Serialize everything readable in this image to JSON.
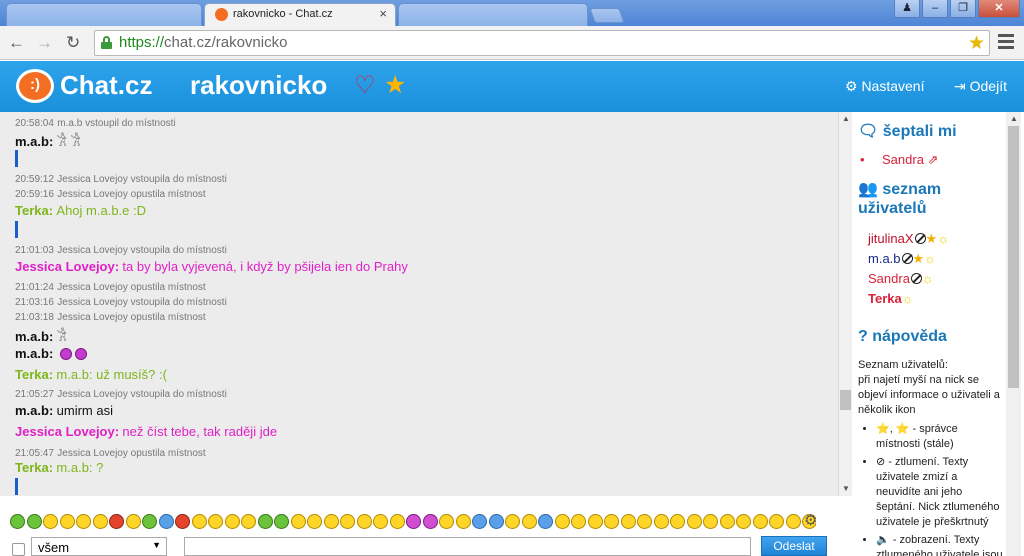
{
  "browser": {
    "tab_title": "rakovnicko - Chat.cz",
    "tab_close": "×",
    "url_scheme": "https://",
    "url_host": "chat.cz",
    "url_path": "/rakovnicko",
    "back": "←",
    "forward": "→",
    "reload": "↻",
    "bookmark_star": "★",
    "win_user": "♟",
    "win_min": "–",
    "win_max": "❐",
    "win_close": "✕"
  },
  "header": {
    "logo_text": "Chat.cz",
    "logo_smile": ":)",
    "room_title": "rakovnicko",
    "heart": "♡",
    "fav_star": "★",
    "settings_label": "⚙ Nastavení",
    "logout_label": "⇥ Odejít"
  },
  "messages": [
    {
      "type": "sys",
      "time": "20:58:04",
      "text": "m.a.b vstoupil do místnosti"
    },
    {
      "type": "chat",
      "nick": "m.a.b:",
      "text": "𓀟 𓀟",
      "color": "mab"
    },
    {
      "type": "bar"
    },
    {
      "type": "sys",
      "time": "20:59:12",
      "text": "Jessica Lovejoy vstoupila do místnosti"
    },
    {
      "type": "sys",
      "time": "20:59:16",
      "text": "Jessica Lovejoy opustila místnost"
    },
    {
      "type": "chat",
      "nick": "Terka:",
      "text": "Ahoj m.a.b.e :D",
      "color": "terka"
    },
    {
      "type": "bar"
    },
    {
      "type": "sys",
      "time": "21:01:03",
      "text": "Jessica Lovejoy vstoupila do místnosti"
    },
    {
      "type": "chat",
      "nick": "Jessica Lovejoy:",
      "text": "ta by byla vyjevená, i když by pšijela ien do Prahy",
      "color": "jess"
    },
    {
      "type": "sys",
      "time": "21:01:24",
      "text": "Jessica Lovejoy opustila místnost"
    },
    {
      "type": "sys",
      "time": "21:03:16",
      "text": "Jessica Lovejoy vstoupila do místnosti"
    },
    {
      "type": "sys",
      "time": "21:03:18",
      "text": "Jessica Lovejoy opustila místnost"
    },
    {
      "type": "chat",
      "nick": "m.a.b:",
      "text": "𓀟",
      "color": "mab"
    },
    {
      "type": "chat",
      "nick": "m.a.b:",
      "text": "",
      "color": "mab",
      "emoticons": 2
    },
    {
      "type": "chat",
      "nick": "Terka:",
      "text": "m.a.b: už musíš? :(",
      "color": "terka"
    },
    {
      "type": "sys",
      "time": "21:05:27",
      "text": "Jessica Lovejoy vstoupila do místnosti"
    },
    {
      "type": "chat",
      "nick": "m.a.b:",
      "text": "umirm asi",
      "color": "mab"
    },
    {
      "type": "chat",
      "nick": "Jessica Lovejoy:",
      "text": "než číst tebe, tak raději jde",
      "color": "jess"
    },
    {
      "type": "sys",
      "time": "21:05:47",
      "text": "Jessica Lovejoy opustila místnost"
    },
    {
      "type": "chat",
      "nick": "Terka:",
      "text": "m.a.b: ?",
      "color": "terka"
    },
    {
      "type": "bar"
    }
  ],
  "sidebar": {
    "whisper_heading": "šeptali mi",
    "whisper_icon": "🗨",
    "whisper_user": "Sandra",
    "whisper_user_icon": "⇗",
    "userlist_heading_1": "seznam",
    "userlist_heading_2": "uživatelů",
    "userlist_icon": "👥",
    "users": [
      {
        "name": "jitulinaX",
        "color": "#c0102a",
        "ban": true,
        "star": true,
        "sun": true,
        "bold": false
      },
      {
        "name": "m.a.b",
        "color": "#1a2a8a",
        "ban": true,
        "star": true,
        "sun": true,
        "bold": false
      },
      {
        "name": "Sandra",
        "color": "#d8223a",
        "ban": true,
        "star": false,
        "sun": true,
        "bold": false
      },
      {
        "name": "Terka",
        "color": "#d8223a",
        "ban": false,
        "star": false,
        "sun": true,
        "bold": true
      }
    ],
    "help_heading": "nápověda",
    "help_icon": "?",
    "help_intro": "Seznam uživatelů:",
    "help_line": "při najetí myší na nick se objeví informace o uživateli a několik ikon",
    "help_items": [
      "⭐, ⭐ - správce místnosti (stále)",
      "⊘ - ztlumení. Texty uživatele zmizí a neuvidíte ani jeho šeptání. Nick ztlumeného uživatele je přeškrtnutý",
      "🔈 - zobrazení. Texty ztlumeného uživatele jsou opět vidět"
    ]
  },
  "bottom": {
    "select_value": "všem",
    "send_label": "Odeslat",
    "gear": "⚙",
    "emoji_colors": [
      "g",
      "g",
      "y",
      "y",
      "y",
      "y",
      "r",
      "y",
      "g",
      "b",
      "r",
      "y",
      "y",
      "y",
      "y",
      "g",
      "g",
      "y",
      "y",
      "y",
      "y",
      "y",
      "y",
      "y",
      "p",
      "p",
      "y",
      "y",
      "b",
      "b",
      "y",
      "y",
      "b",
      "y",
      "y",
      "y",
      "y",
      "y",
      "y",
      "y",
      "y",
      "y",
      "y",
      "y",
      "y",
      "y",
      "y",
      "y",
      "y"
    ]
  }
}
